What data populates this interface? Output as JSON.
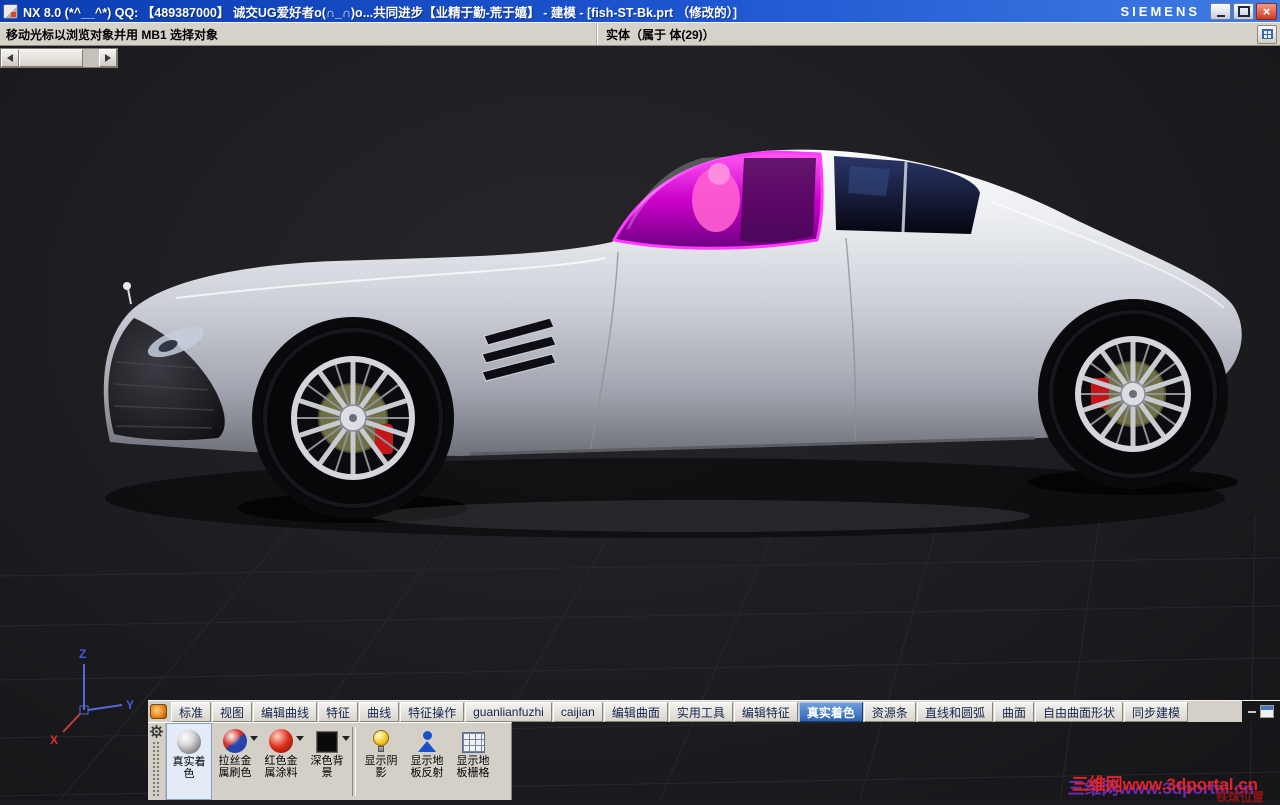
{
  "window": {
    "title": "NX 8.0 (*^__^*) QQ: 【489387000】 诚交UG爱好者o(∩_∩)o...共同进步【业精于勤-荒于嬉】 - 建模 - [fish-ST-Bk.prt （修改的）]",
    "brand": "SIEMENS",
    "close_glyph": "×"
  },
  "message_bar": {
    "prompt": "移动光标以浏览对象并用 MB1 选择对象",
    "status": "实体（属于 体(29)）"
  },
  "tabs": {
    "items": [
      "标准",
      "视图",
      "编辑曲线",
      "特征",
      "曲线",
      "特征操作",
      "guanlianfuzhi",
      "caijian",
      "编辑曲面",
      "实用工具",
      "编辑特征",
      "真实着色",
      "资源条",
      "直线和圆弧",
      "曲面",
      "自由曲面形状",
      "同步建模"
    ],
    "selected": "真实着色"
  },
  "toolbar": {
    "items": [
      {
        "label": "真实着色",
        "icon": "gray-sphere-icon",
        "selected": true
      },
      {
        "label": "拉丝金属刷色",
        "icon": "red-blue-sphere-icon",
        "dropdown": true
      },
      {
        "label": "红色金属涂料",
        "icon": "red-sphere-icon",
        "dropdown": true
      },
      {
        "label": "深色背景",
        "icon": "black-square-icon",
        "dropdown": true
      },
      {
        "label": "显示阴影",
        "icon": "lightbulb-icon"
      },
      {
        "label": "显示地板反射",
        "icon": "person-icon"
      },
      {
        "label": "显示地板栅格",
        "icon": "grid-icon"
      }
    ]
  },
  "viewport": {
    "axes": {
      "x": "X",
      "y": "Y",
      "z": "Z"
    },
    "watermark": "三维网www.3dportal.cn",
    "watermark_sub": "铁球位置"
  },
  "colors": {
    "titlebar_blue": "#1e56d0",
    "selected_tab_blue": "#2d63b4",
    "close_red": "#cf3a22",
    "canopy_magenta": "#cc00cc",
    "canopy_outline": "#ff3cff",
    "body_silver": "#cdd0d8",
    "caliper_red": "#c41616",
    "viewport_bg": "#1d1d21",
    "panel_gray": "#d4d0c8"
  }
}
